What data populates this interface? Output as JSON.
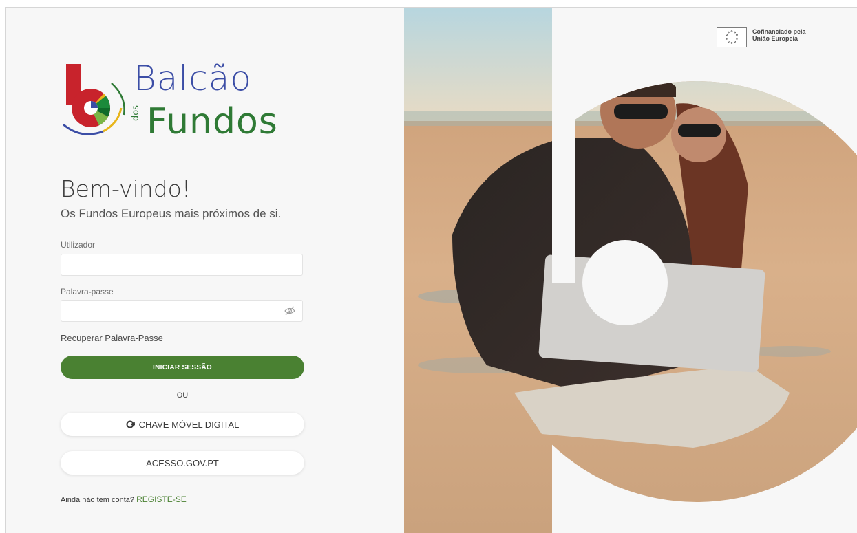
{
  "brand": {
    "name_top": "Balcão",
    "name_small": "dos",
    "name_main": "Fundos",
    "colors": {
      "blue": "#3c4ea6",
      "green": "#2f7a35",
      "red": "#c8232c",
      "accent_green": "#4a8132"
    }
  },
  "eu_badge": {
    "line1": "Cofinanciado pela",
    "line2": "União Europeia"
  },
  "welcome": {
    "title": "Bem-vindo!",
    "subtitle": "Os Fundos Europeus mais próximos de si."
  },
  "form": {
    "username_label": "Utilizador",
    "username_value": "",
    "password_label": "Palavra-passe",
    "password_value": "",
    "recover_link": "Recuperar Palavra-Passe",
    "login_button": "INICIAR SESSÃO",
    "or_text": "OU",
    "cmd_button": "CHAVE MÓVEL DIGITAL",
    "gov_button": "ACESSO.GOV.PT"
  },
  "register": {
    "prompt": "Ainda não tem conta?",
    "link": "REGISTE-SE"
  },
  "icons": {
    "password_toggle": "eye-off-icon",
    "cmd": "mobile-key-icon",
    "eu_flag": "eu-flag-icon"
  }
}
